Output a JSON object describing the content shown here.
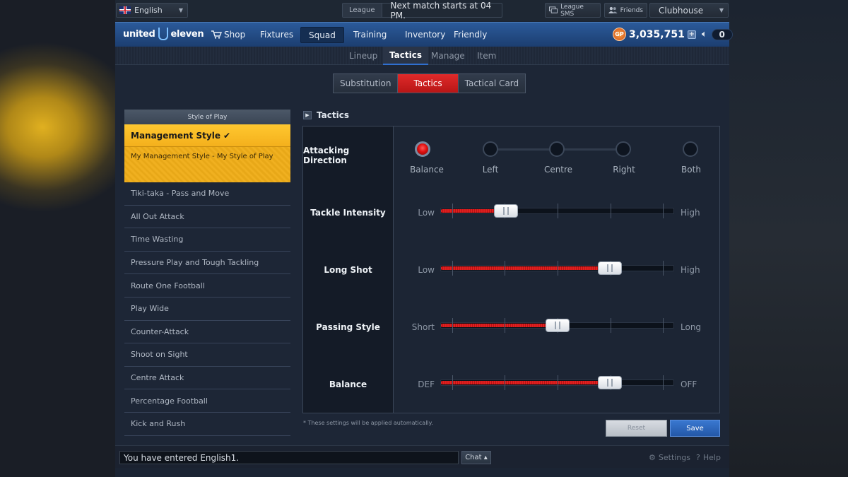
{
  "top": {
    "language": "English",
    "league_tag": "League",
    "league_message": "Next match starts at 04 PM.",
    "league_sms": "League SMS",
    "friends": "Friends",
    "club_select": "Clubhouse"
  },
  "logo": {
    "left": "united",
    "right": "eleven"
  },
  "nav": {
    "items": [
      "Shop",
      "Fixtures",
      "Squad",
      "Training",
      "Inventory",
      "Friendly"
    ],
    "active": "Squad",
    "gp_icon": "GP",
    "gp_value": "3,035,751",
    "gp_plus": "+",
    "message_count": "0"
  },
  "subnav": {
    "items": [
      "Lineup",
      "Tactics",
      "Manage",
      "Item"
    ],
    "active": "Tactics"
  },
  "segment": {
    "items": [
      "Substitution",
      "Tactics",
      "Tactical Card"
    ],
    "active": "Tactics"
  },
  "style_panel": {
    "header": "Style of Play",
    "selected_title": "Management Style",
    "selected_check": "✔",
    "selected_sub": "My Management Style - My Style of Play",
    "styles": [
      "Tiki-taka - Pass and Move",
      "All Out Attack",
      "Time Wasting",
      "Pressure Play and Tough Tackling",
      "Route One Football",
      "Play Wide",
      "Counter-Attack",
      "Shoot on Sight",
      "Centre Attack",
      "Percentage Football",
      "Kick and Rush"
    ]
  },
  "tactics": {
    "title": "Tactics",
    "attacking_direction": {
      "label": "Attacking Direction",
      "options": [
        "Balance",
        "Left",
        "Centre",
        "Right",
        "Both"
      ],
      "selected": "Balance"
    },
    "sliders": [
      {
        "label": "Tackle Intensity",
        "low": "Low",
        "high": "High",
        "value": 0.28
      },
      {
        "label": "Long Shot",
        "low": "Low",
        "high": "High",
        "value": 0.725
      },
      {
        "label": "Passing Style",
        "low": "Short",
        "high": "Long",
        "value": 0.5
      },
      {
        "label": "Balance",
        "low": "DEF",
        "high": "OFF",
        "value": 0.725
      }
    ],
    "note": "* These settings will be applied automatically.",
    "reset_label": "Reset",
    "save_label": "Save"
  },
  "bottom": {
    "chat_text": "You have entered English1.",
    "chat_button": "Chat ▴",
    "settings": "Settings",
    "help": "Help"
  },
  "colors": {
    "accent_red": "#e02020",
    "nav_blue": "#2b5a9a",
    "style_yellow": "#f4b01c"
  }
}
